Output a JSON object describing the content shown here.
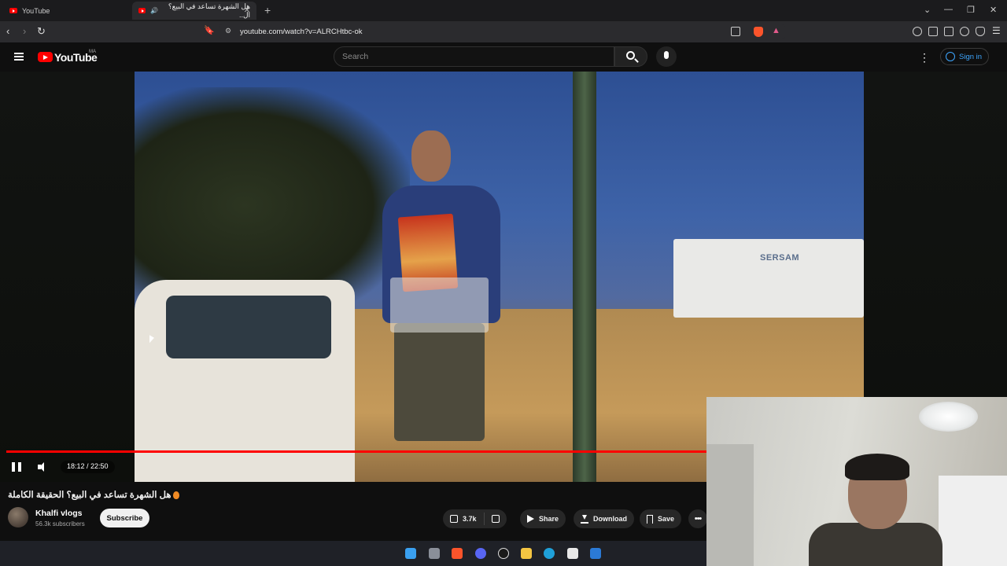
{
  "browser": {
    "tabs": [
      {
        "label": "YouTube",
        "active": false
      },
      {
        "label": "هل الشهرة تساعد في البيع؟ ال..",
        "active": true
      }
    ],
    "url": "youtube.com/watch?v=ALRCHtbc-ok"
  },
  "youtube": {
    "logo_text": "YouTube",
    "country_code": "MA",
    "search_placeholder": "Search",
    "sign_in_label": "Sign in"
  },
  "video": {
    "scene_sign_text": "SERSAM",
    "time_display": "18:12 / 22:50",
    "progress": 0.7956,
    "title": "هل الشهرة تساعد في البيع؟ الحقيقة الكاملة",
    "channel": {
      "name": "Khalfi vlogs",
      "subscribers": "56.3k subscribers",
      "subscribe_label": "Subscribe"
    },
    "actions": {
      "likes": "3.7k",
      "share_label": "Share",
      "download_label": "Download",
      "save_label": "Save"
    }
  },
  "colors": {
    "accent_red": "#ff0000",
    "link_blue": "#3ea6ff",
    "background": "#0f0f0f"
  }
}
